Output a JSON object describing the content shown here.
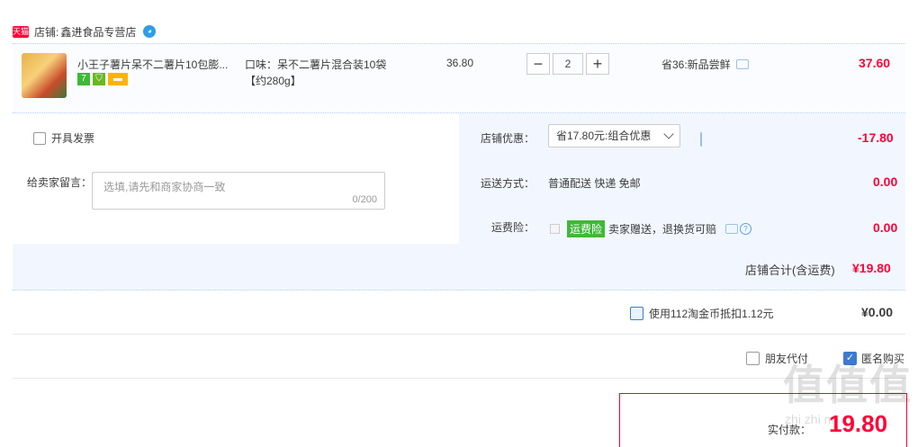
{
  "shop": {
    "label": "店铺:",
    "name": "鑫进食品专营店",
    "tmall_badge": "天猫"
  },
  "item": {
    "title": "小王子薯片呆不二薯片10包膨...",
    "badge_7": "7",
    "sku_line1": "口味：呆不二薯片混合装10袋",
    "sku_line2": "【约280g】",
    "unit_price": "36.80",
    "qty_minus": "−",
    "qty_value": "2",
    "qty_plus": "+",
    "promo": "省36:新品尝鲜",
    "total": "37.60"
  },
  "options": {
    "invoice_label": "开具发票",
    "msg_label": "给卖家留言：",
    "msg_placeholder": "选填,请先和商家协商一致",
    "msg_count": "0/200",
    "shop_discount_label": "店铺优惠：",
    "shop_discount_value": "省17.80元:组合优惠",
    "shop_discount_amount": "-17.80",
    "shipping_label": "运送方式：",
    "shipping_value": "普通配送 快递 免邮",
    "shipping_amount": "0.00",
    "insurance_label": "运费险：",
    "insurance_tag": "运费险",
    "insurance_text": "卖家赠送，退换货可赔",
    "insurance_amount": "0.00",
    "shop_total_label": "店铺合计(含运费)",
    "shop_total": "¥19.80"
  },
  "coins": {
    "label": "使用112淘金币抵扣1.12元",
    "amount": "¥0.00"
  },
  "extras": {
    "friend_pay": "朋友代付",
    "anonymous": "匿名购买"
  },
  "pay": {
    "label": "实付款：",
    "amount": "19.80"
  },
  "watermark": {
    "glyphs": "值值值",
    "site": "zhi zhi m"
  },
  "colors": {
    "price_red": "#ff0036",
    "blue_accent": "#3d7ad1",
    "green_tag": "#3fb838"
  }
}
